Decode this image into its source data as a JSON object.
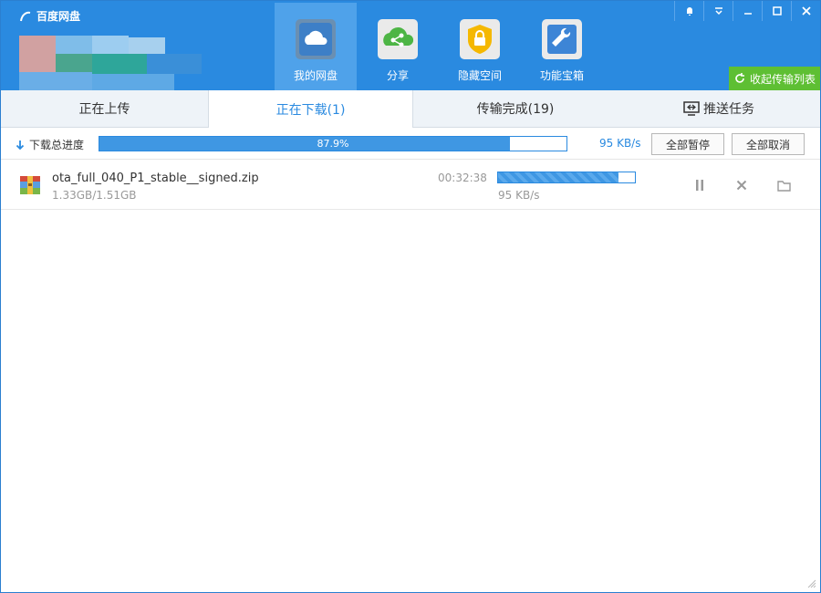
{
  "app": {
    "title": "百度网盘"
  },
  "nav": [
    {
      "label": "我的网盘",
      "icon": "cloud-icon",
      "active": true
    },
    {
      "label": "分享",
      "icon": "share-icon",
      "active": false
    },
    {
      "label": "隐藏空间",
      "icon": "lock-icon",
      "active": false
    },
    {
      "label": "功能宝箱",
      "icon": "wrench-icon",
      "active": false
    }
  ],
  "header": {
    "collapse_label": "收起传输列表"
  },
  "tabs": [
    {
      "label": "正在上传"
    },
    {
      "label": "正在下载(1)"
    },
    {
      "label": "传输完成(19)"
    },
    {
      "label": "推送任务"
    }
  ],
  "progress": {
    "label": "下载总进度",
    "percent_text": "87.9%",
    "percent": 87.9,
    "speed": "95 KB/s",
    "pause_all": "全部暂停",
    "cancel_all": "全部取消"
  },
  "downloads": [
    {
      "name": "ota_full_040_P1_stable__signed.zip",
      "size": "1.33GB/1.51GB",
      "time_left": "00:32:38",
      "speed": "95 KB/s",
      "progress": 88
    }
  ],
  "colors": {
    "header": "#2a8ae0",
    "accent": "#2a8ae0",
    "collapse": "#5ebf33"
  }
}
